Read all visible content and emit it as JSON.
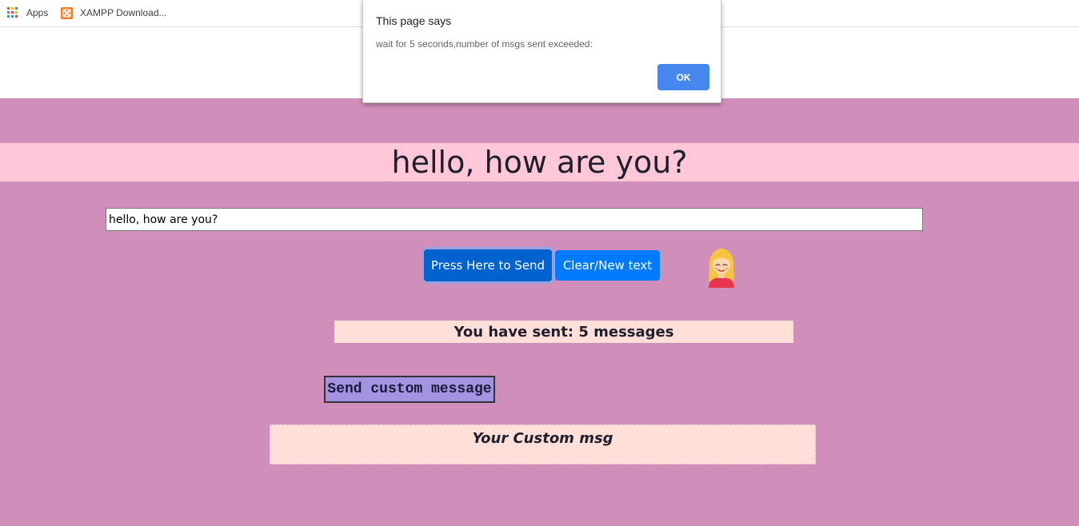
{
  "bookmarks": {
    "apps_label": "Apps",
    "xampp_label": "XAMPP Download..."
  },
  "page": {
    "heading": "hello, how are you?",
    "input_value": "hello, how are you?",
    "send_button": "Press Here to Send",
    "clear_button": "Clear/New text",
    "avatar_icon": "girl-emoji-icon",
    "counter_text": "You have sent: 5 messages",
    "custom_button": "Send custom message",
    "custom_box_text": "Your Custom msg"
  },
  "dialog": {
    "title": "This page says",
    "message": "wait for 5 seconds,number of msgs sent exceeded:",
    "ok_button": "OK"
  },
  "colors": {
    "page_background": "#d08fbb",
    "heading_band": "#ffc8d9",
    "send_button": "#0062cc",
    "clear_button": "#007bff",
    "counter_background": "#ffdfd8",
    "custom_button": "#a393e0",
    "dialog_ok": "#4687ee"
  }
}
